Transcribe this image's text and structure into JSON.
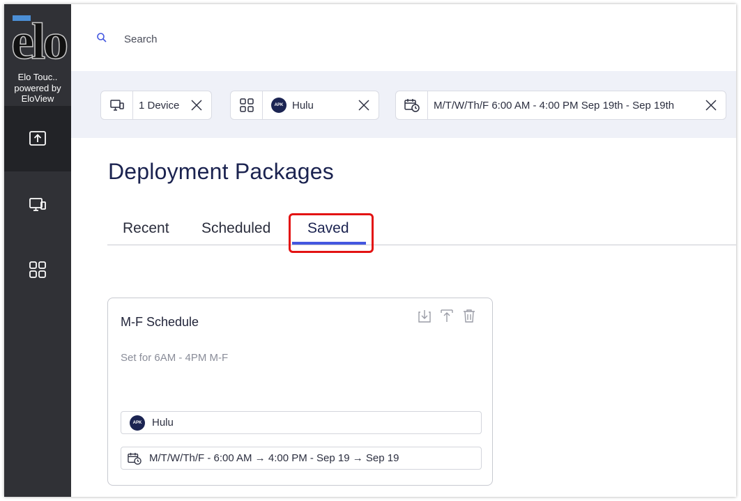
{
  "sidebar": {
    "logo_text": "elo",
    "brand_line1": "Elo Touc..",
    "brand_line2": "powered by",
    "brand_line3": "EloView",
    "items": [
      {
        "icon": "upload-icon",
        "active": true
      },
      {
        "icon": "devices-icon",
        "active": false
      },
      {
        "icon": "apps-grid-icon",
        "active": false
      }
    ]
  },
  "search": {
    "placeholder": "Search"
  },
  "filters": {
    "device_chip": "1 Device",
    "app_badge": "APK",
    "app_chip": "Hulu",
    "schedule_chip": "M/T/W/Th/F  6:00 AM  - 4:00 PM  Sep 19th - Sep 19th"
  },
  "main": {
    "title": "Deployment Packages",
    "tabs": [
      {
        "label": "Recent"
      },
      {
        "label": "Scheduled"
      },
      {
        "label": "Saved"
      }
    ],
    "selected_tab": "Saved"
  },
  "card": {
    "title": "M-F Schedule",
    "description": "Set for 6AM - 4PM M-F",
    "app_badge": "APK",
    "app_name": "Hulu",
    "schedule": "M/T/W/Th/F   - 6:00 AM → 4:00 PM - Sep 19 → Sep 19"
  },
  "colors": {
    "sidebar_bg": "#303136",
    "accent": "#4357e0",
    "highlight": "#e31313",
    "title": "#1b2350"
  }
}
